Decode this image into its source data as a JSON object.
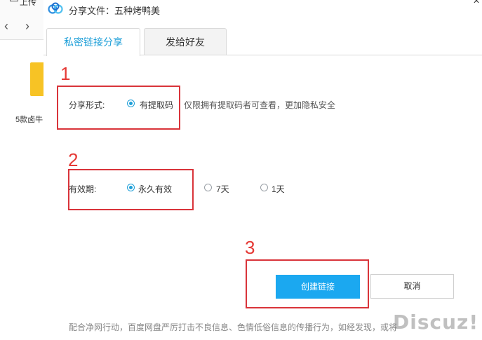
{
  "background_app": {
    "upload_label": "上传",
    "back_glyph": "‹",
    "forward_glyph": "›",
    "folder_label": "5款卤牛"
  },
  "dialog": {
    "title": "分享文件：五种烤鸭美",
    "close_glyph": "×",
    "tabs": [
      {
        "label": "私密链接分享",
        "active": true
      },
      {
        "label": "发给好友",
        "active": false
      }
    ],
    "steps": [
      "1",
      "2",
      "3"
    ],
    "share_form": {
      "label": "分享形式:",
      "option": "有提取码",
      "hint": "仅限拥有提取码者可查看，更加隐私安全"
    },
    "validity": {
      "label": "有效期:",
      "options": [
        {
          "label": "永久有效",
          "selected": true
        },
        {
          "label": "7天",
          "selected": false
        },
        {
          "label": "1天",
          "selected": false
        }
      ]
    },
    "buttons": {
      "create": "创建链接",
      "cancel": "取消"
    },
    "footer": "配合净网行动，百度网盘严厉打击不良信息、色情低俗信息的传播行为，如经发现，或将",
    "watermark": "Discuz!"
  },
  "colors": {
    "accent": "#1e9fd8",
    "primary_button": "#1ba8f0",
    "annotation_red": "#d9343a",
    "folder": "#f7c325"
  }
}
